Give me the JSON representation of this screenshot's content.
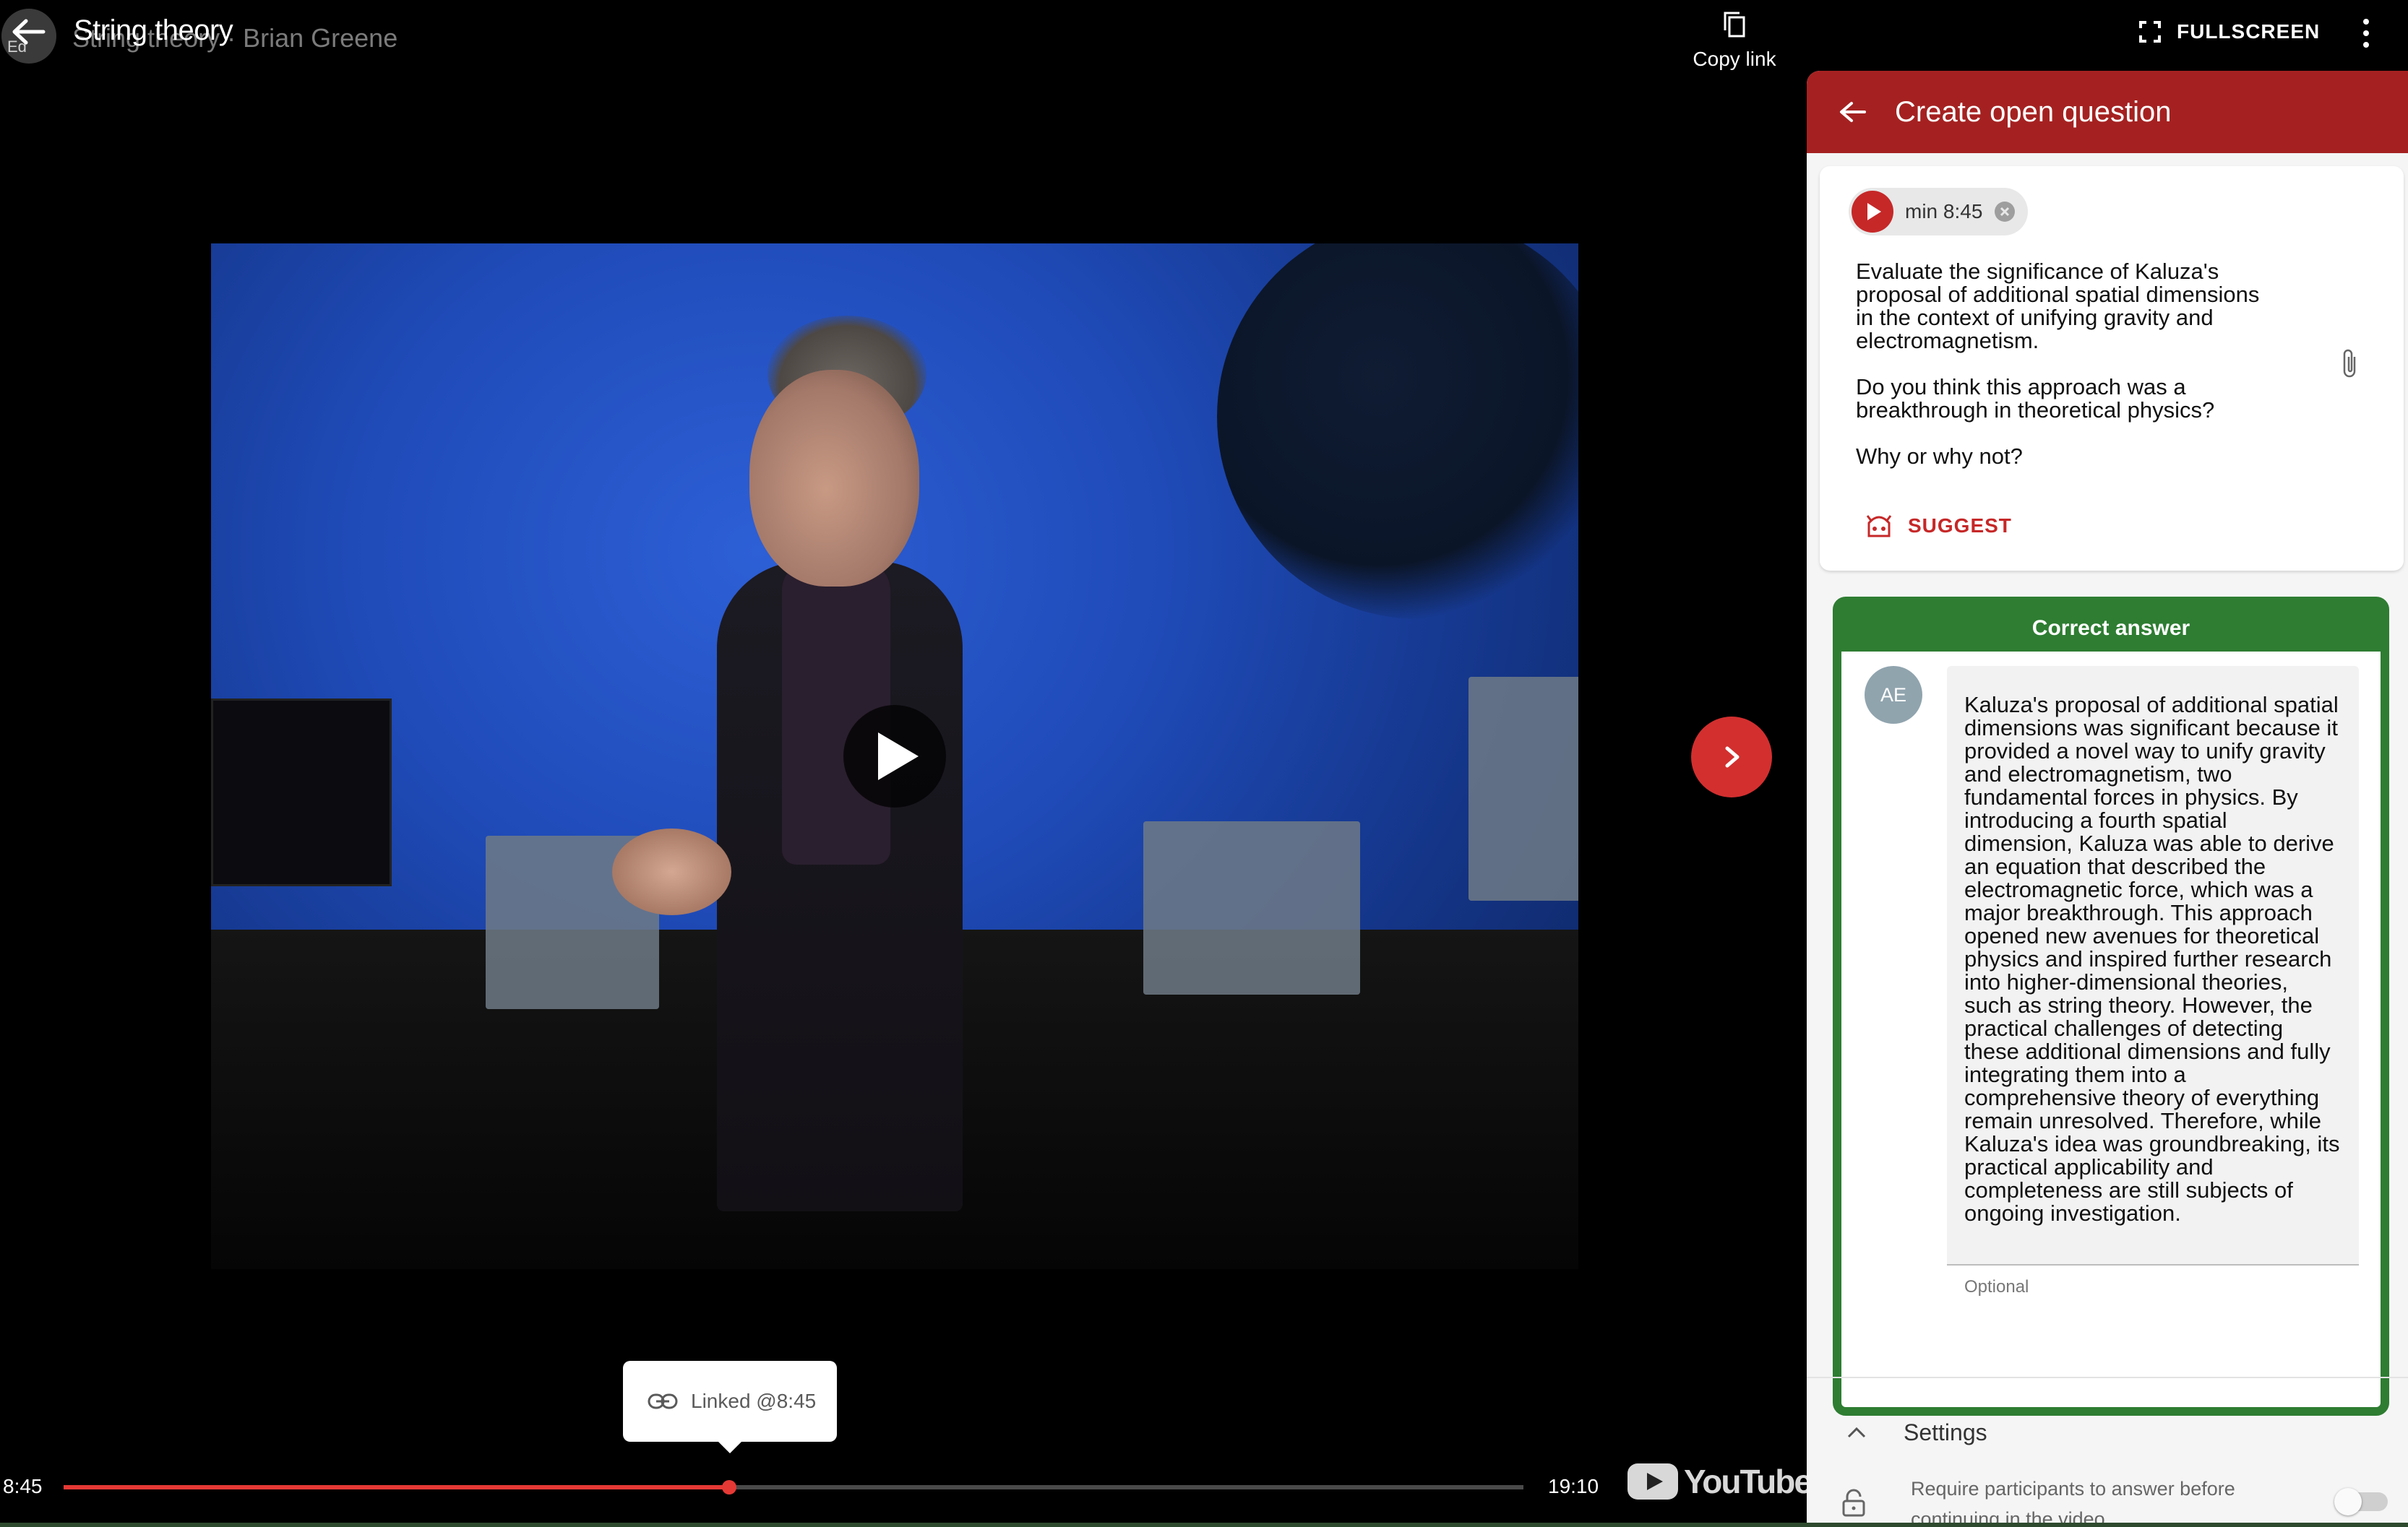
{
  "video": {
    "title": "String theory",
    "ghost_title": "String theory · Brian Greene",
    "avatar_initials": "Ed",
    "current_time": "8:45",
    "total_time": "19:10",
    "progress_fraction": 0.456,
    "copy_link_label": "Copy link",
    "fullscreen_label": "FULLSCREEN",
    "linked_tooltip": "Linked @8:45",
    "youtube_wordmark": "YouTube"
  },
  "panel": {
    "title": "Create open question",
    "chip_label": "min 8:45",
    "question_text": "Evaluate the significance of Kaluza's\nproposal of additional spatial dimensions\nin the context of unifying gravity and\nelectromagnetism.\n\nDo you think this approach was a\nbreakthrough in theoretical physics?\n\nWhy or why not?",
    "suggest_label": "SUGGEST",
    "answer_header": "Correct answer",
    "answer_avatar": "AE",
    "answer_text": "Kaluza's proposal of additional spatial dimensions was significant because it provided a novel way to unify gravity and electromagnetism, two fundamental forces in physics. By introducing a fourth spatial dimension, Kaluza was able to derive an equation that described the electromagnetic force, which was a major breakthrough. This approach opened new avenues for theoretical physics and inspired further research into higher-dimensional theories, such as string theory. However, the practical challenges of detecting these additional dimensions and fully integrating them into a comprehensive theory of everything remain unresolved. Therefore, while Kaluza's idea was groundbreaking, its practical applicability and completeness are still subjects of ongoing investigation.",
    "answer_optional": "Optional",
    "settings_label": "Settings",
    "require_text": "Require participants to answer before continuing in the video",
    "require_enabled": false
  },
  "colors": {
    "accent_red": "#a52121",
    "correct_green": "#2e7d32",
    "progress_red": "#e53935"
  },
  "icons": [
    "back-arrow-icon",
    "copy-icon",
    "fullscreen-icon",
    "more-vert-icon",
    "play-icon",
    "chevron-right-icon",
    "link-icon",
    "close-circle-icon",
    "attach-icon",
    "robot-icon",
    "chevron-up-icon",
    "lock-icon"
  ]
}
